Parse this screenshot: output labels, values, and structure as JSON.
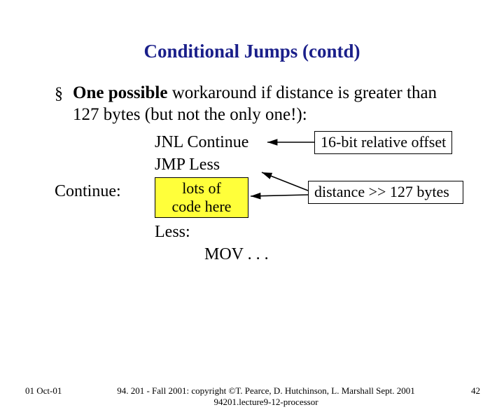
{
  "title": "Conditional Jumps (contd)",
  "bullet": {
    "marker": "§",
    "text_html": "<b>One possible</b> workaround if distance is greater than 127 bytes (but not the only one!):"
  },
  "code": {
    "jnl": "JNL   Continue",
    "jmp": "JMP  Less",
    "continue_label": "Continue:",
    "lots_l1": "lots of",
    "lots_l2": "code here",
    "less_label": "Less:",
    "mov": "MOV . . ."
  },
  "annotations": {
    "offset16": "16-bit relative offset",
    "distance": "distance >> 127 bytes"
  },
  "footer": {
    "date": "01 Oct-01",
    "center_l1": "94. 201 - Fall 2001: copyright ©T. Pearce, D. Hutchinson, L. Marshall Sept. 2001",
    "center_l2": "94201.lecture9-12-processor",
    "page": "42"
  }
}
